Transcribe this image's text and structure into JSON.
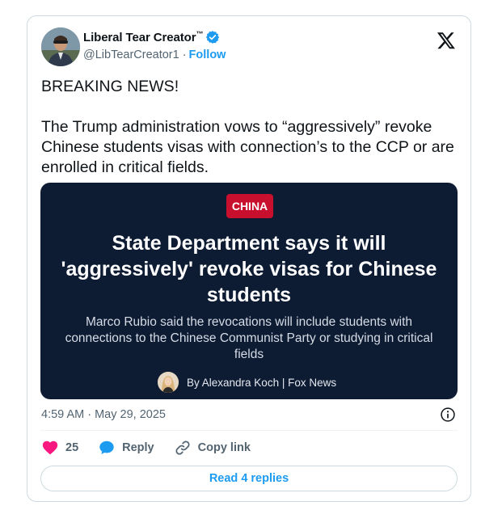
{
  "author": {
    "display_name": "Liberal Tear Creator",
    "trademark": "™",
    "handle": "@LibTearCreator1",
    "separator": "·",
    "follow_label": "Follow"
  },
  "tweet": {
    "text": "BREAKING NEWS!\n\nThe Trump administration vows to “aggressively” revoke Chinese students visas with connection’s to the CCP or are enrolled in critical fields."
  },
  "media_card": {
    "category": "CHINA",
    "headline": "State Department says it will 'aggressively' revoke visas for Chinese students",
    "subhead": "Marco Rubio said the revocations will include students with connections to the Chinese Communist Party or studying in critical fields",
    "byline": "By Alexandra Koch | Fox News"
  },
  "meta": {
    "timestamp": "4:59 AM · May 29, 2025"
  },
  "actions": {
    "likes": "25",
    "reply_label": "Reply",
    "copy_link_label": "Copy link"
  },
  "replies_button": {
    "label": "Read 4 replies"
  },
  "colors": {
    "accent": "#1d9bf0",
    "like": "#f91880",
    "card_bg": "#0d1b33",
    "chip_red": "#c8102e",
    "muted": "#536471"
  },
  "icons": [
    "verified-badge-icon",
    "x-logo-icon",
    "info-icon",
    "heart-icon",
    "reply-bubble-icon",
    "link-icon"
  ]
}
